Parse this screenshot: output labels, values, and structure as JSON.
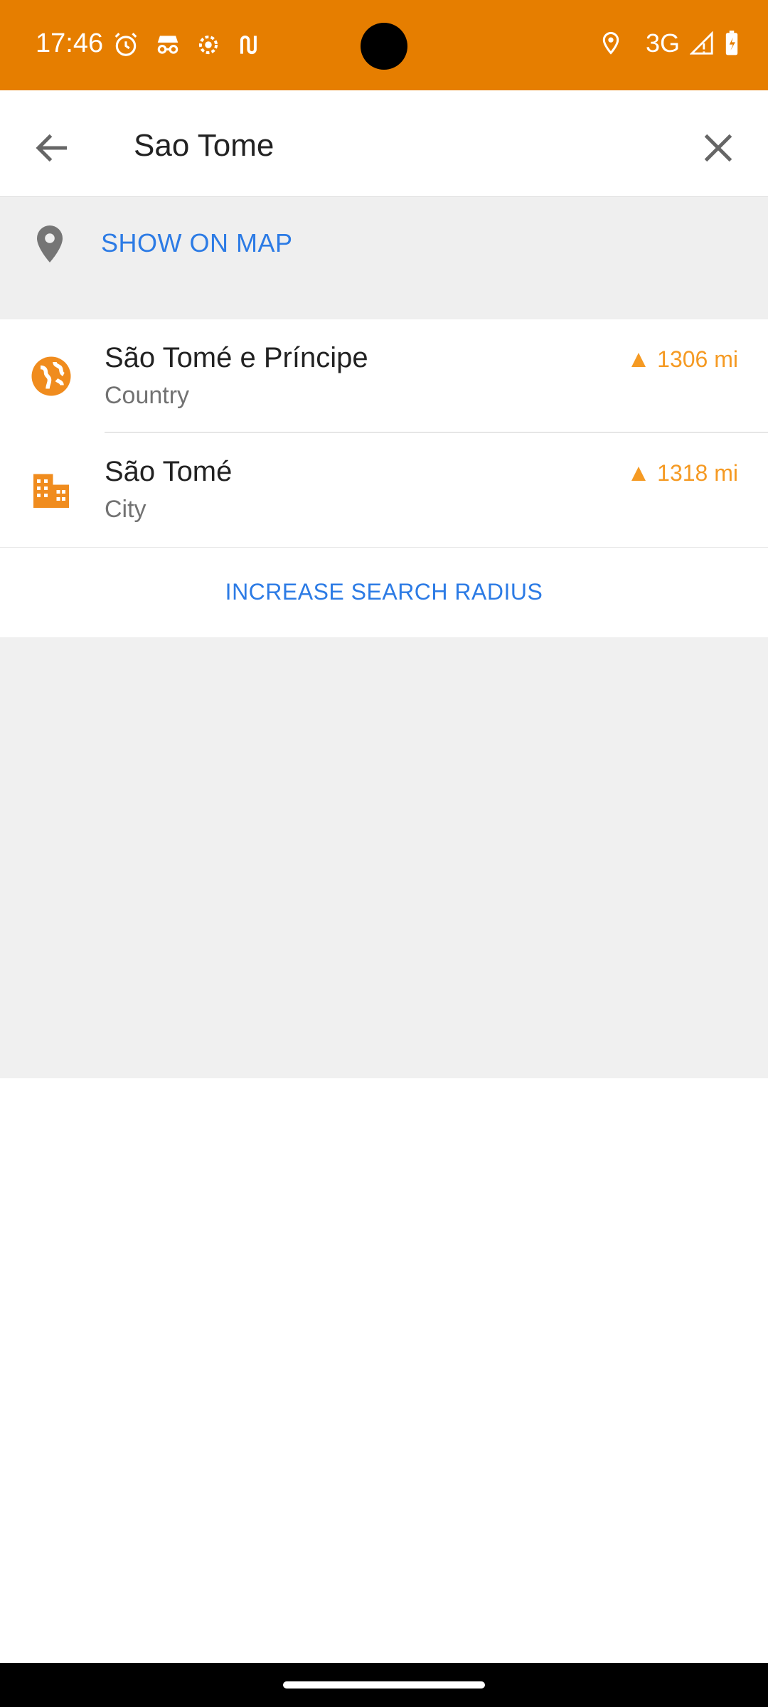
{
  "status_bar": {
    "time": "17:46",
    "icons_left": [
      "alarm-icon",
      "incognito-icon",
      "settings-icon",
      "route-icon"
    ],
    "network": "3G",
    "icons_right": [
      "location-icon",
      "signal-icon",
      "battery-charging-icon"
    ],
    "background": "#E67E00"
  },
  "search": {
    "query": "Sao Tome",
    "back_icon": "arrow-left-icon",
    "clear_icon": "close-icon"
  },
  "show_on_map": {
    "label": "SHOW ON MAP",
    "icon": "map-pin-icon"
  },
  "results": [
    {
      "title": "São Tomé e Príncipe",
      "subtitle": "Country",
      "distance": "1306 mi",
      "icon": "globe-icon"
    },
    {
      "title": "São Tomé",
      "subtitle": "City",
      "distance": "1318 mi",
      "icon": "city-buildings-icon"
    }
  ],
  "increase_radius": {
    "label": "INCREASE SEARCH RADIUS"
  },
  "colors": {
    "accent_blue": "#2C7BE5",
    "accent_orange": "#F59A23",
    "icon_orange": "#F08C1E"
  }
}
